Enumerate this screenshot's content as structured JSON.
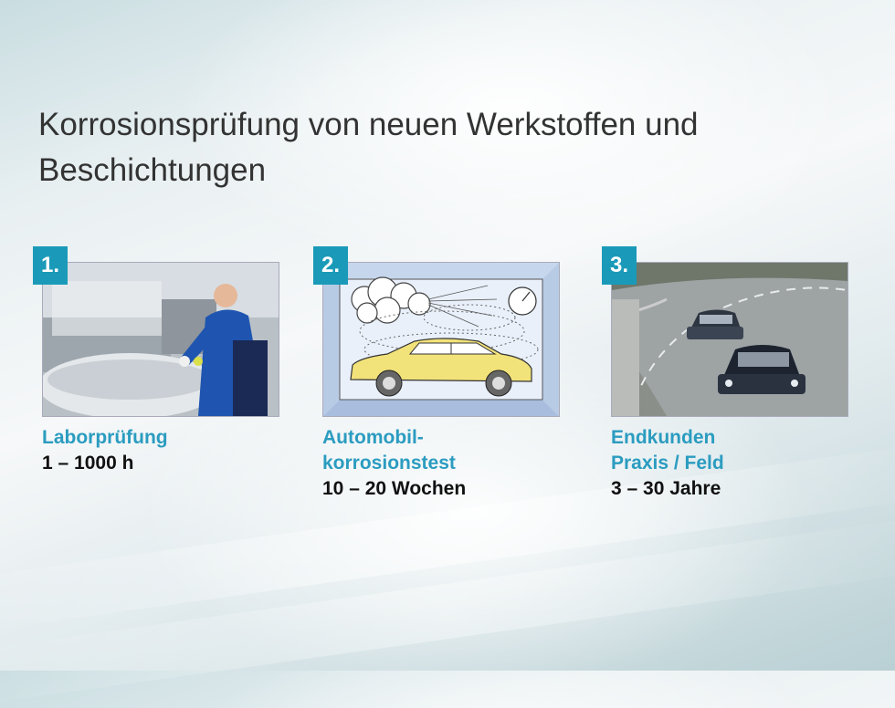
{
  "slide": {
    "title": "Korrosionsprüfung von neuen Werkstoffen und Beschichtungen"
  },
  "panels": [
    {
      "number": "1.",
      "caption_lines": [
        "Laborprüfung"
      ],
      "duration": "1 – 1000 h",
      "image": "lab-technician-salt-spray-chamber"
    },
    {
      "number": "2.",
      "caption_lines": [
        "Automobil-",
        "korrosionstest"
      ],
      "duration": "10 – 20 Wochen",
      "image": "car-in-corrosion-test-chamber-illustration"
    },
    {
      "number": "3.",
      "caption_lines": [
        "Endkunden",
        "Praxis / Feld"
      ],
      "duration": "3 – 30 Jahre",
      "image": "cars-driving-on-wet-road"
    }
  ],
  "colors": {
    "accent": "#1a9ab8",
    "caption_blue": "#2b9cc0",
    "title_text": "#333333"
  }
}
